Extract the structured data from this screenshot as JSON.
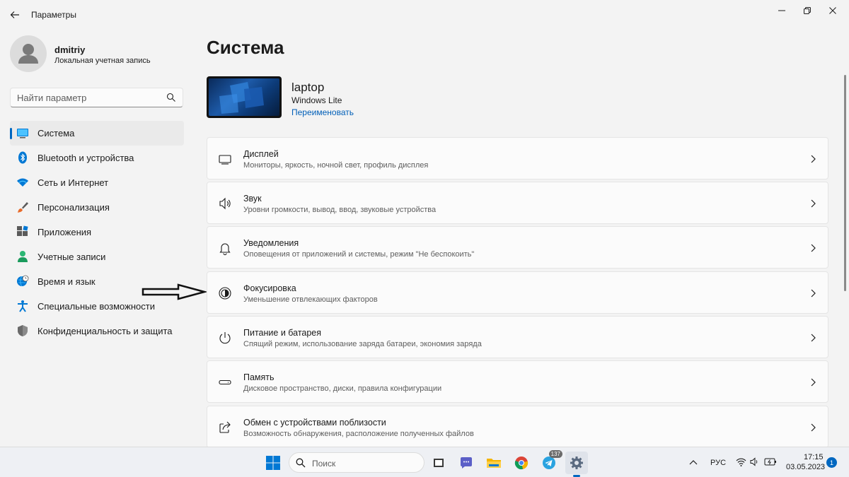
{
  "window": {
    "title": "Параметры"
  },
  "profile": {
    "name": "dmitriy",
    "account_type": "Локальная учетная запись"
  },
  "search": {
    "placeholder": "Найти параметр"
  },
  "nav": {
    "items": [
      {
        "label": "Система",
        "icon": "monitor-icon",
        "active": true
      },
      {
        "label": "Bluetooth и устройства",
        "icon": "bluetooth-icon"
      },
      {
        "label": "Сеть и Интернет",
        "icon": "wifi-icon"
      },
      {
        "label": "Персонализация",
        "icon": "brush-icon"
      },
      {
        "label": "Приложения",
        "icon": "apps-icon"
      },
      {
        "label": "Учетные записи",
        "icon": "account-icon"
      },
      {
        "label": "Время и язык",
        "icon": "globe-clock-icon"
      },
      {
        "label": "Специальные возможности",
        "icon": "accessibility-icon"
      },
      {
        "label": "Конфиденциальность и защита",
        "icon": "shield-icon"
      }
    ]
  },
  "main": {
    "title": "Система",
    "device": {
      "name": "laptop",
      "os": "Windows Lite",
      "rename_label": "Переименовать"
    },
    "cards": [
      {
        "title": "Дисплей",
        "desc": "Мониторы, яркость, ночной свет, профиль дисплея",
        "icon": "display-icon"
      },
      {
        "title": "Звук",
        "desc": "Уровни громкости, вывод, ввод, звуковые устройства",
        "icon": "speaker-icon"
      },
      {
        "title": "Уведомления",
        "desc": "Оповещения от приложений и системы, режим \"Не беспокоить\"",
        "icon": "bell-icon"
      },
      {
        "title": "Фокусировка",
        "desc": "Уменьшение отвлекающих факторов",
        "icon": "focus-icon"
      },
      {
        "title": "Питание и батарея",
        "desc": "Спящий режим, использование заряда батареи, экономия заряда",
        "icon": "power-icon"
      },
      {
        "title": "Память",
        "desc": "Дисковое пространство, диски, правила конфигурации",
        "icon": "storage-icon"
      },
      {
        "title": "Обмен с устройствами поблизости",
        "desc": "Возможность обнаружения, расположение полученных файлов",
        "icon": "share-icon"
      }
    ]
  },
  "taskbar": {
    "search_label": "Поиск",
    "telegram_badge": "137",
    "language": "РУС",
    "time": "17:15",
    "date": "03.05.2023",
    "notifications": "1"
  },
  "colors": {
    "accent": "#0067c0",
    "link": "#005fb8",
    "background": "#f3f3f3",
    "card": "#fbfbfb"
  }
}
